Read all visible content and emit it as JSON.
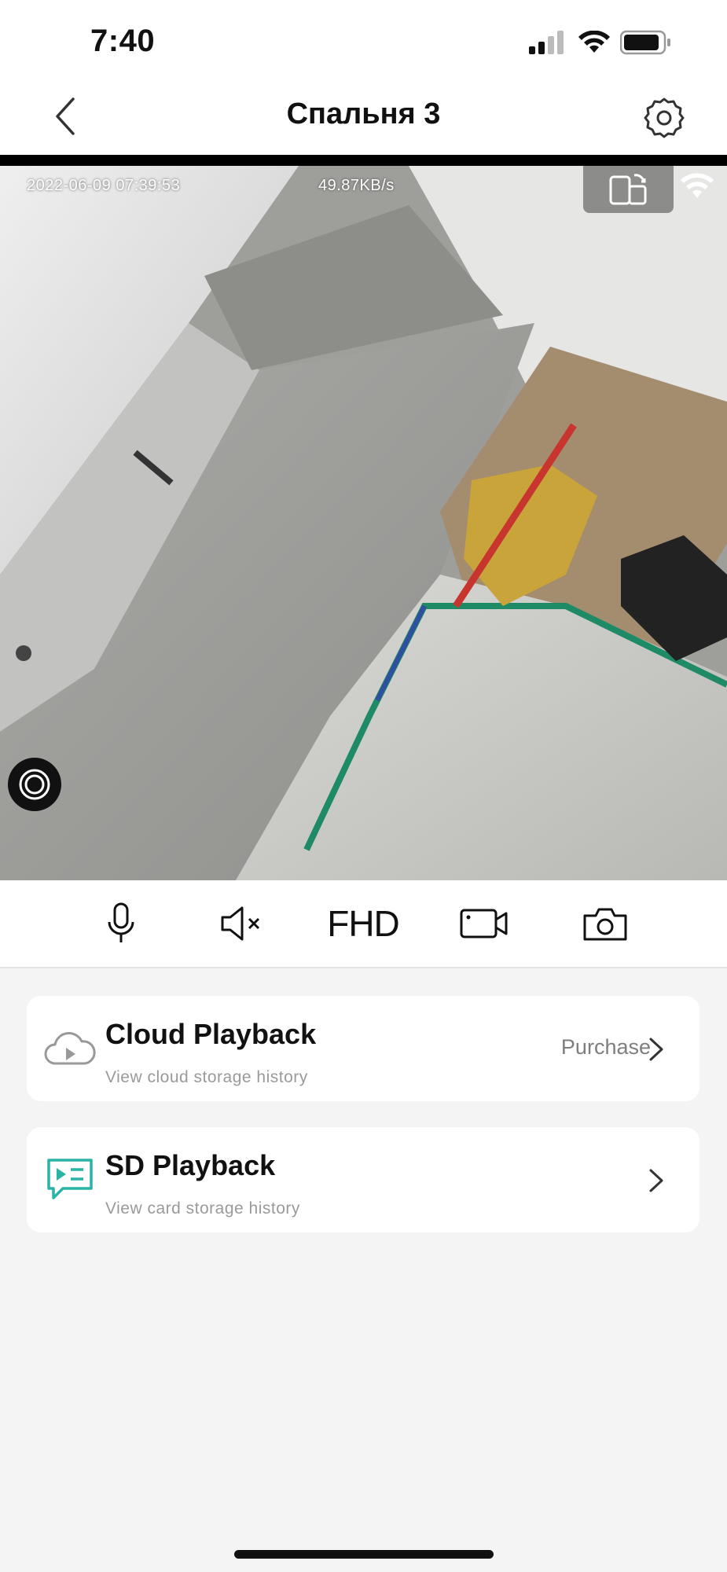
{
  "status_bar": {
    "time": "7:40",
    "icons": [
      "signal-icon",
      "wifi-icon",
      "battery-icon"
    ]
  },
  "nav": {
    "title": "Спальня 3",
    "back_icon": "chevron-left-icon",
    "settings_icon": "gear-icon"
  },
  "video": {
    "timestamp": "2022-06-09 07:39:53",
    "bitrate": "49.87KB/s",
    "rotate_icon": "rotate-screen-icon",
    "wifi_icon": "wifi-icon",
    "lens_icon": "lens-icon"
  },
  "controls": {
    "microphone_icon": "microphone-icon",
    "mute_icon": "speaker-mute-icon",
    "quality_label": "FHD",
    "record_icon": "video-record-icon",
    "snapshot_icon": "camera-icon"
  },
  "cards": {
    "cloud": {
      "title": "Cloud Playback",
      "subtitle": "View cloud storage history",
      "action": "Purchase",
      "icon": "cloud-play-icon"
    },
    "sd": {
      "title": "SD Playback",
      "subtitle": "View card storage history",
      "icon": "sd-playback-icon"
    }
  },
  "colors": {
    "accent_teal": "#2bb3a6",
    "background": "#f4f4f4",
    "card": "#ffffff"
  }
}
